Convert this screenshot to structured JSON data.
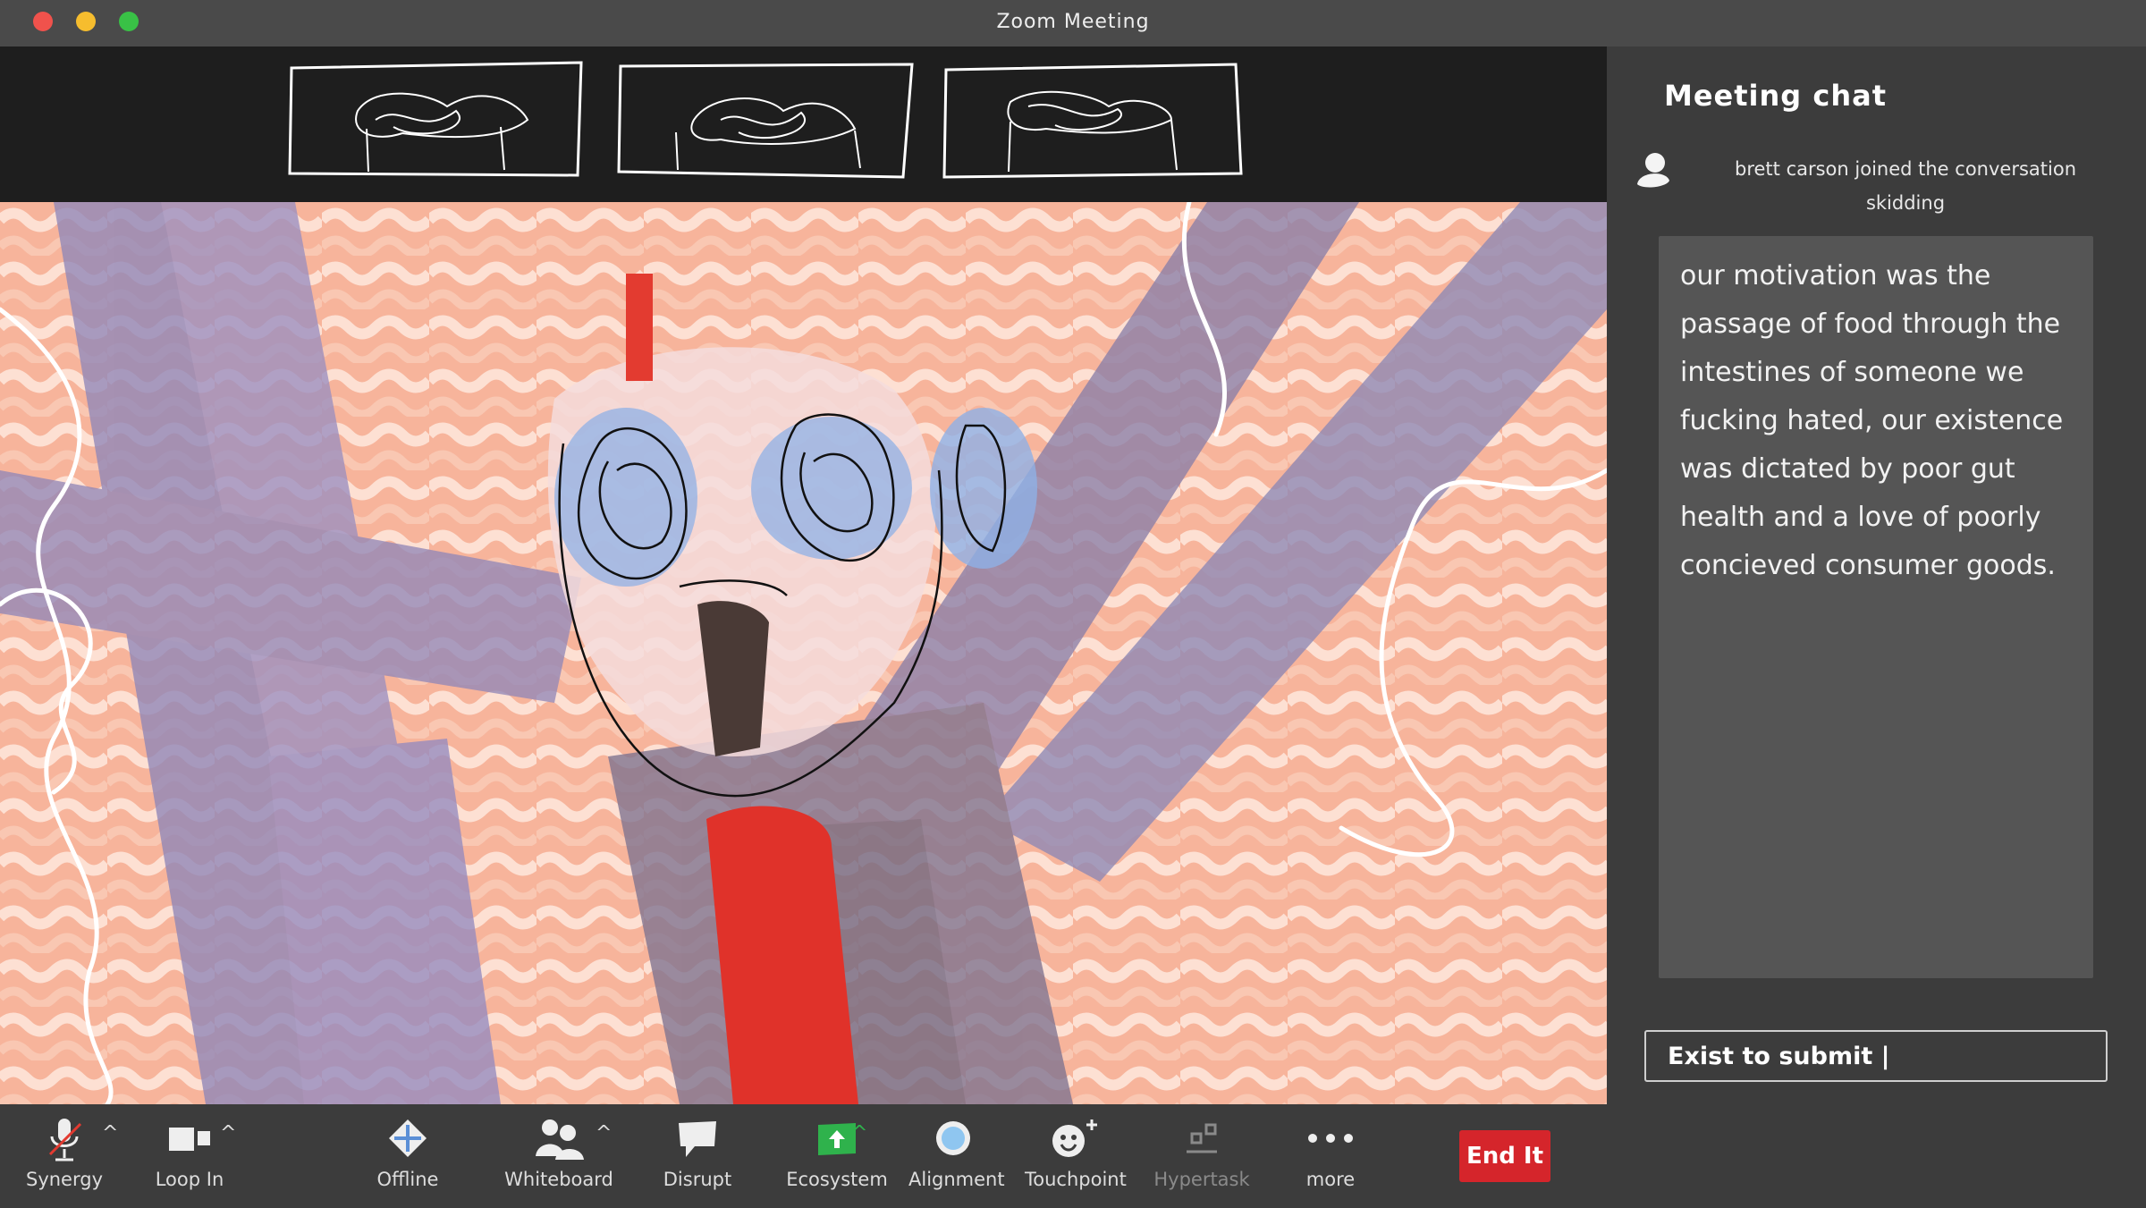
{
  "window": {
    "title": "Zoom Meeting"
  },
  "chat": {
    "title": "Meeting chat",
    "join_line1": "brett carson  joined the conversation",
    "join_line2": "skidding",
    "message": "our motivation was the passage of food through the intestines of someone we fucking hated, our existence was dictated by poor gut health and a love of poorly concieved consumer goods.",
    "input_value": "Exist to submit |"
  },
  "toolbar": {
    "items": [
      {
        "label": "Synergy",
        "icon": "mic-muted-icon"
      },
      {
        "label": "Loop In",
        "icon": "video-camera-icon"
      },
      {
        "label": "Offline",
        "icon": "diamond-icon"
      },
      {
        "label": "Whiteboard",
        "icon": "participants-icon"
      },
      {
        "label": "Disrupt",
        "icon": "chat-bubble-icon"
      },
      {
        "label": "Ecosystem",
        "icon": "share-screen-icon"
      },
      {
        "label": "Alignment",
        "icon": "record-icon"
      },
      {
        "label": "Touchpoint",
        "icon": "reaction-icon"
      },
      {
        "label": "Hypertask",
        "icon": "apps-icon"
      },
      {
        "label": "more",
        "icon": "more-dots-icon"
      }
    ],
    "end_label": "End It",
    "caret": "^"
  },
  "colors": {
    "end_button": "#d5252b",
    "share_green": "#2fb24c",
    "panel_bg": "#3c3c3c",
    "video_bg": "#f7b9a0"
  }
}
